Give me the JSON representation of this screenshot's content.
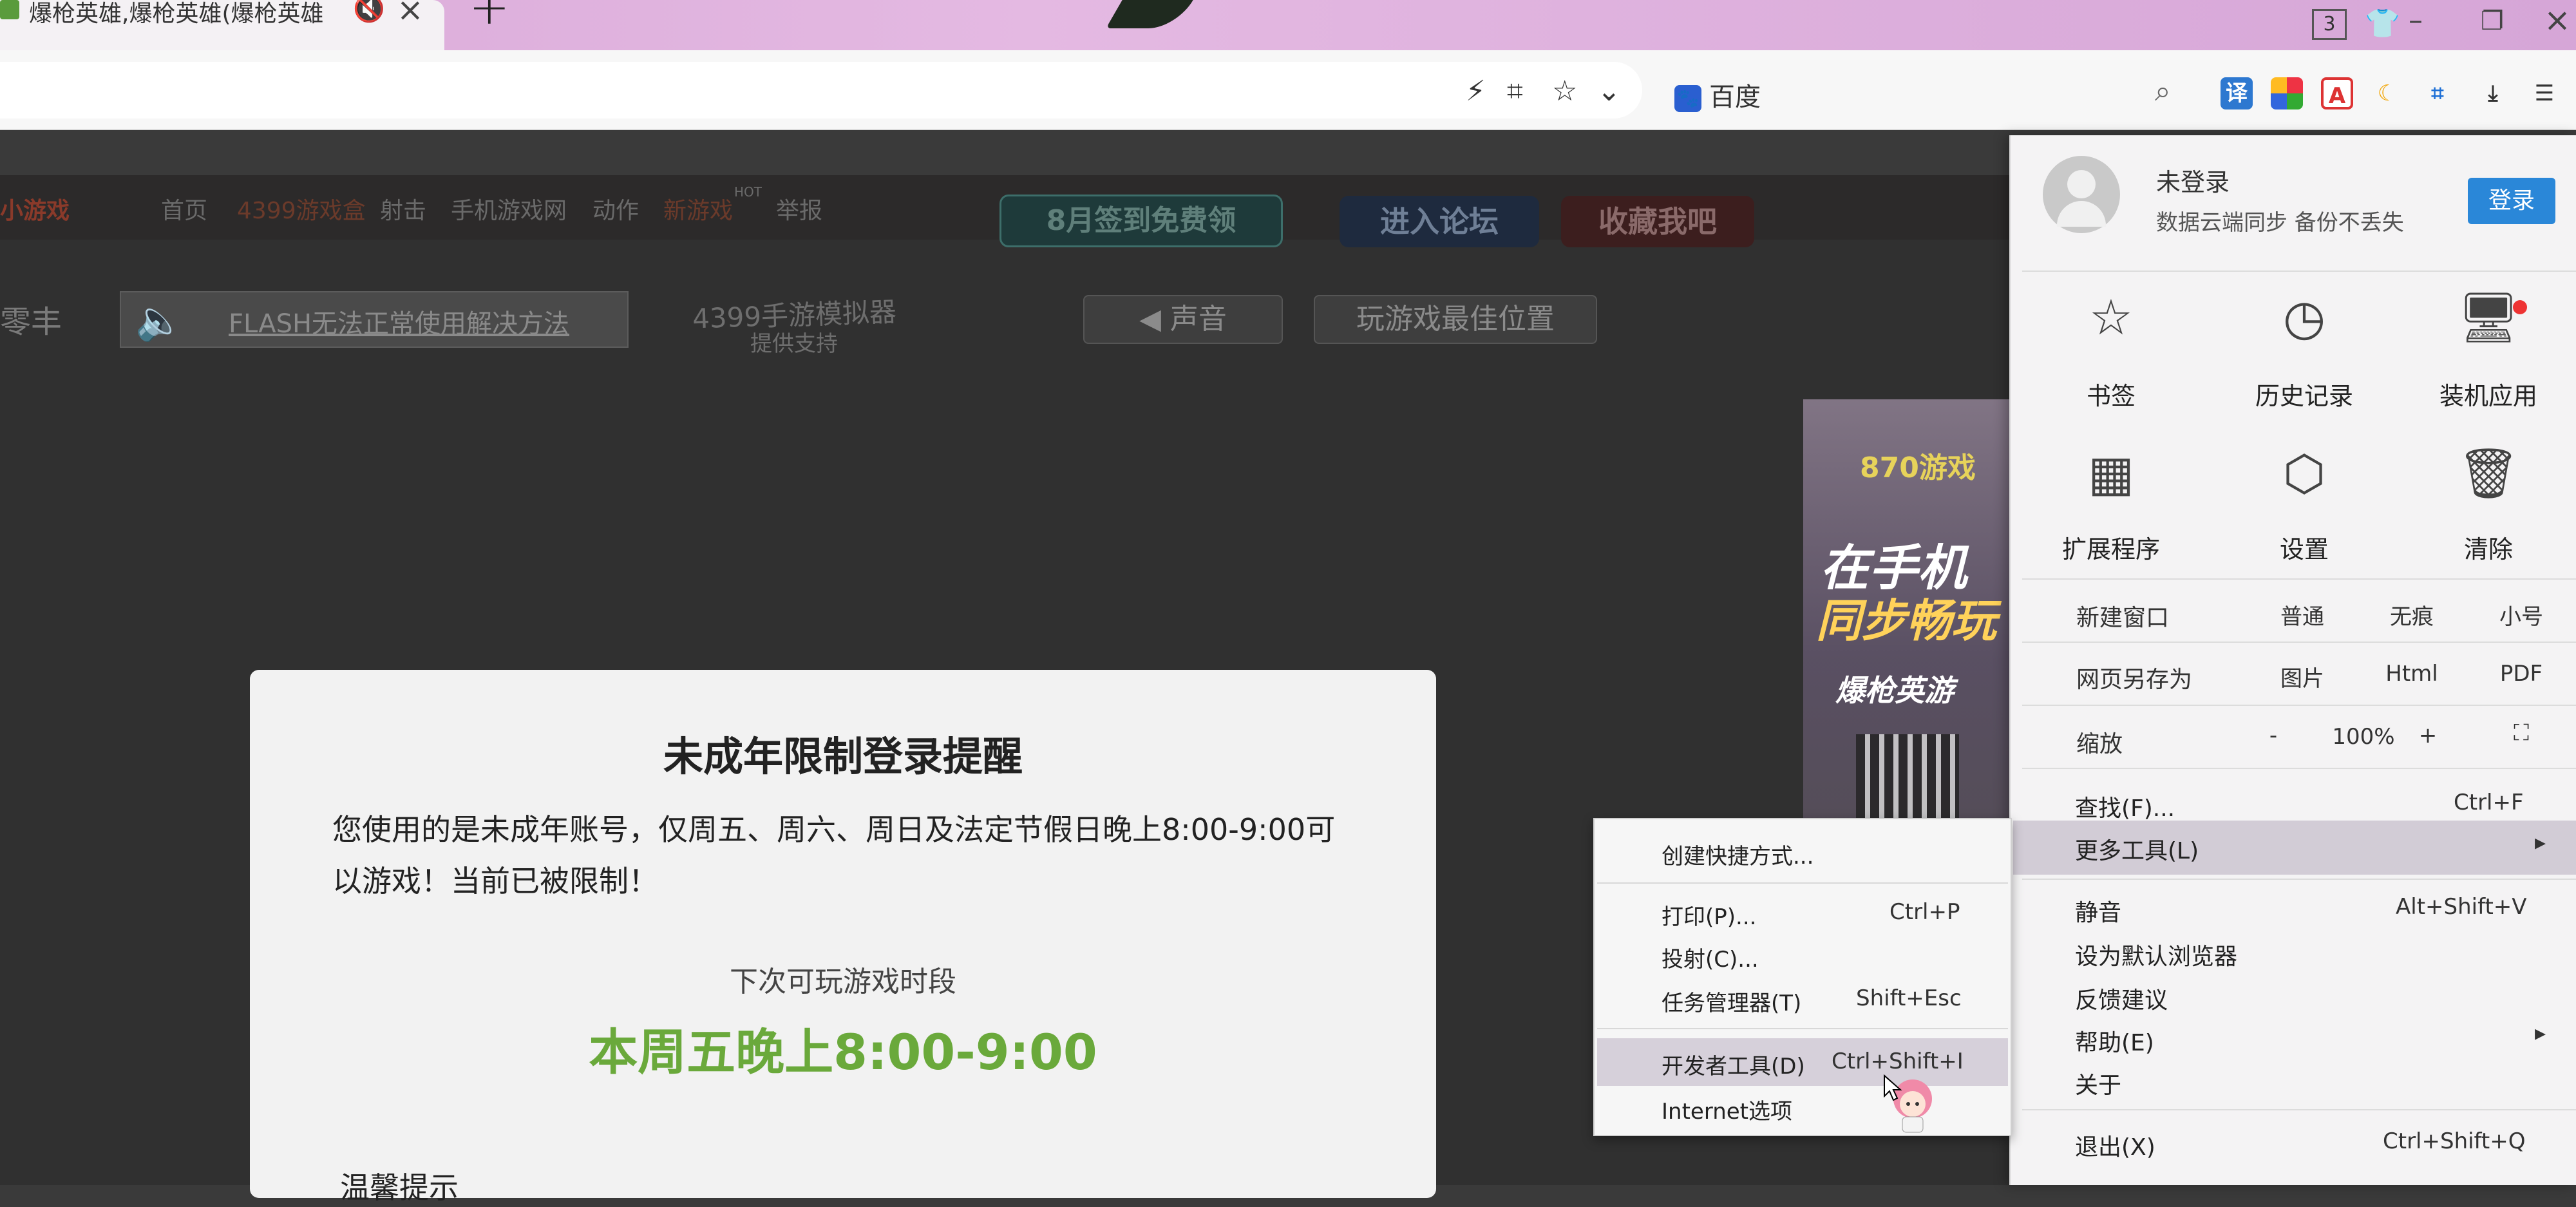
{
  "browser": {
    "tab": {
      "title": "爆枪英雄,爆枪英雄(爆枪英雄",
      "audio_icon": "speaker-mute-icon",
      "close": "×"
    },
    "new_tab": "+",
    "tab_count": "3",
    "search_engine": "百度",
    "search_engine_logo": "🐾",
    "extension_badges": [
      "译",
      "A",
      "☾"
    ]
  },
  "site": {
    "logo": "小游戏",
    "nav": [
      "首页",
      "4399游戏盒",
      "射击",
      "手机游戏网",
      "动作",
      "新游戏",
      "举报"
    ],
    "nav_hot": "HOT",
    "pill_signin": "8月签到免费领",
    "pill_forum": "进入论坛",
    "pill_fav": "收藏我吧",
    "left_cut": "零丰",
    "flash_link": "FLASH无法正常使用解决方法",
    "emu_title": "4399手游模拟器",
    "emu_sub": "提供支持",
    "sound_btn": "声音",
    "best_pos_btn": "玩游戏最佳位置",
    "ad": {
      "brand": "870游戏",
      "line1": "在手机",
      "line2": "同步畅玩",
      "game": "爆枪英游"
    }
  },
  "modal": {
    "title": "未成年限制登录提醒",
    "body": "您使用的是未成年账号，仅周五、周六、周日及法定节假日晚上8:00-9:00可以游戏！当前已被限制！",
    "next_label": "下次可玩游戏时段",
    "next_time": "本周五晚上8:00-9:00",
    "tip": "温馨提示"
  },
  "menu": {
    "user": {
      "name": "未登录",
      "sub": "数据云端同步 备份不丢失",
      "login": "登录"
    },
    "grid": [
      {
        "label": "书签",
        "icon": "star-icon"
      },
      {
        "label": "历史记录",
        "icon": "clock-icon"
      },
      {
        "label": "装机应用",
        "icon": "monitor-icon"
      },
      {
        "label": "扩展程序",
        "icon": "grid-icon"
      },
      {
        "label": "设置",
        "icon": "gear-icon"
      },
      {
        "label": "清除",
        "icon": "trash-icon"
      }
    ],
    "new_window": {
      "label": "新建窗口",
      "opts": [
        "普通",
        "无痕",
        "小号"
      ]
    },
    "save_as": {
      "label": "网页另存为",
      "opts": [
        "图片",
        "Html",
        "PDF"
      ]
    },
    "zoom": {
      "label": "缩放",
      "minus": "-",
      "value": "100%",
      "plus": "+",
      "fullscreen": "⛶"
    },
    "find": {
      "label": "查找(F)...",
      "key": "Ctrl+F"
    },
    "more_tools": {
      "label": "更多工具(L)",
      "arrow": "▸"
    },
    "mute": {
      "label": "静音",
      "key": "Alt+Shift+V"
    },
    "default_browser": "设为默认浏览器",
    "feedback": "反馈建议",
    "help": {
      "label": "帮助(E)",
      "arrow": "▸"
    },
    "about": "关于",
    "exit": {
      "label": "退出(X)",
      "key": "Ctrl+Shift+Q"
    }
  },
  "submenu": {
    "create_shortcut": "创建快捷方式...",
    "print": {
      "label": "打印(P)...",
      "key": "Ctrl+P"
    },
    "cast": "投射(C)...",
    "task_manager": {
      "label": "任务管理器(T)",
      "key": "Shift+Esc"
    },
    "devtools": {
      "label": "开发者工具(D)",
      "key": "Ctrl+Shift+I"
    },
    "internet_options": "Internet选项"
  },
  "colors": {
    "accent_green": "#6aa93b",
    "login_blue": "#2a87d8",
    "tab_bg": "#e4b9e2"
  }
}
